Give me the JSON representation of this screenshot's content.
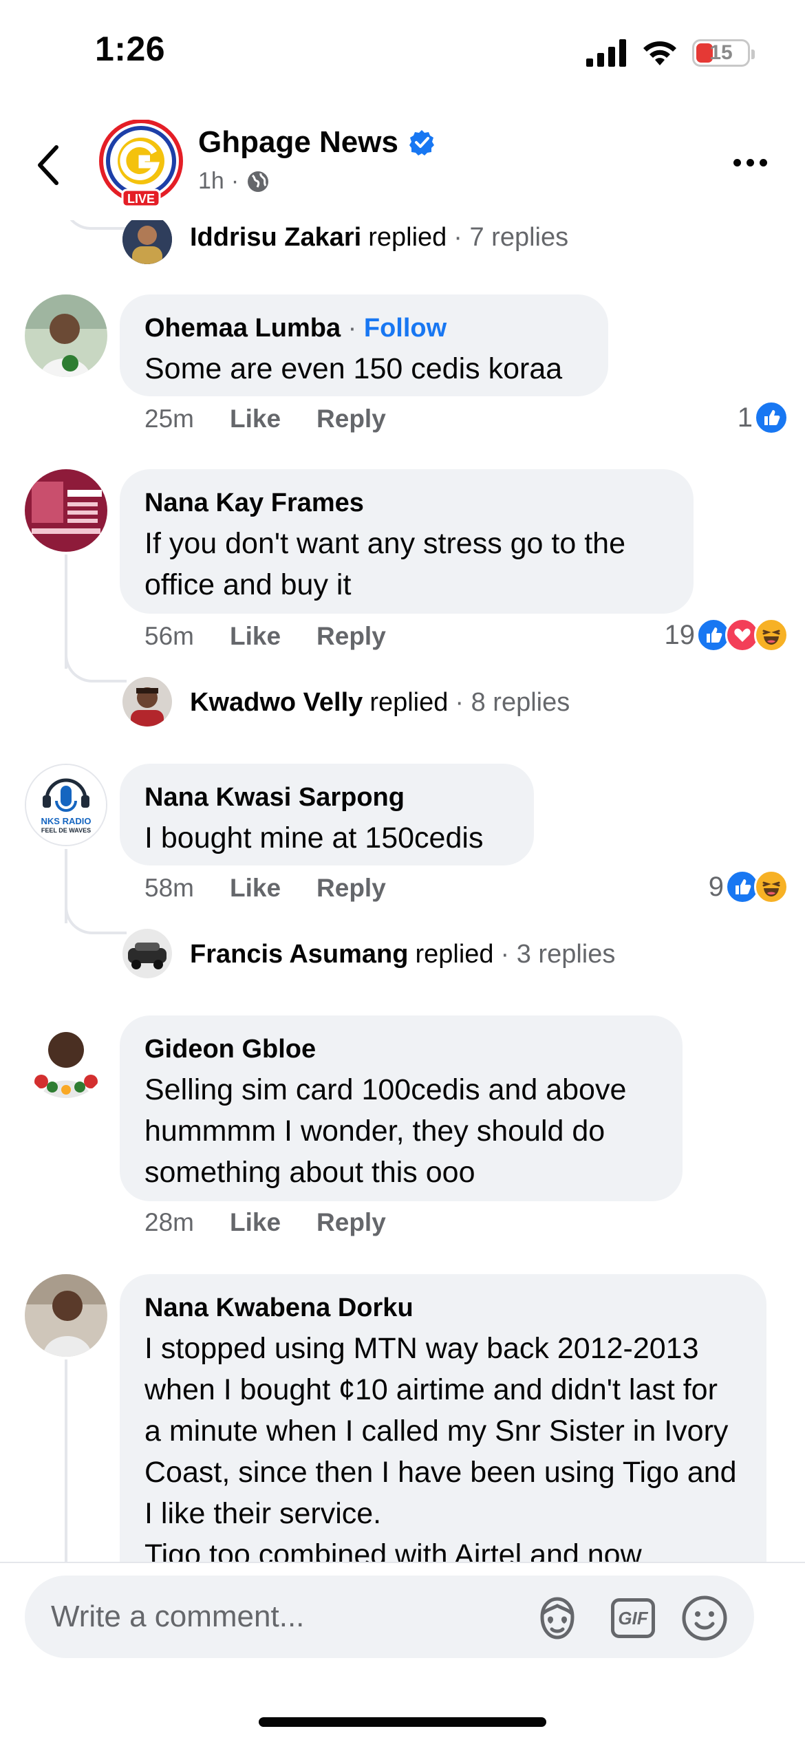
{
  "status_bar": {
    "time": "1:26",
    "battery_level": "15"
  },
  "header": {
    "page_name": "Ghpage News",
    "post_time": "1h",
    "live_badge": "LIVE",
    "verified": true
  },
  "top_reply": {
    "name": "Iddrisu Zakari",
    "replied_text": "replied",
    "reply_count": "· 7 replies"
  },
  "comments": [
    {
      "name": "Ohemaa Lumba",
      "follow_sep": " · ",
      "follow_label": "Follow",
      "text": "Some are even 150 cedis koraa",
      "time": "25m",
      "like_label": "Like",
      "reply_label": "Reply",
      "reaction_count": "1",
      "reactions": [
        "like-icon"
      ]
    },
    {
      "name": "Nana Kay Frames",
      "text": "If you don't want any stress go to the office and buy it",
      "time": "56m",
      "like_label": "Like",
      "reply_label": "Reply",
      "reaction_count": "19",
      "reactions": [
        "like-icon",
        "love-icon",
        "haha-icon"
      ],
      "replied": {
        "name": "Kwadwo Velly",
        "replied_text": "replied",
        "reply_count": "· 8 replies"
      }
    },
    {
      "name": "Nana Kwasi Sarpong",
      "avatar_text": "NKS RADIO",
      "avatar_subtext": "FEEL DE WAVES",
      "text": "I bought mine at 150cedis",
      "time": "58m",
      "like_label": "Like",
      "reply_label": "Reply",
      "reaction_count": "9",
      "reactions": [
        "like-icon",
        "haha-icon"
      ],
      "replied": {
        "name": "Francis Asumang",
        "replied_text": "replied",
        "reply_count": "· 3 replies"
      }
    },
    {
      "name": "Gideon Gbloe",
      "text": "Selling sim card 100cedis and above hummmm I wonder, they should do something about this ooo",
      "time": "28m",
      "like_label": "Like",
      "reply_label": "Reply"
    },
    {
      "name": "Nana Kwabena Dorku",
      "text": "I stopped using MTN way back 2012-2013 when I bought ¢10 airtime and didn't last for a minute when I called my Snr Sister in Ivory Coast, since then I have been using Tigo and I like their service.\nTigo too combined with Airtel and now"
    }
  ],
  "composer": {
    "placeholder": "Write a comment...",
    "gif_label": "GIF"
  },
  "colors": {
    "accent_blue": "#1877f2",
    "bubble_bg": "#f0f2f5",
    "secondary_text": "#65676b",
    "battery_red": "#e53935"
  }
}
